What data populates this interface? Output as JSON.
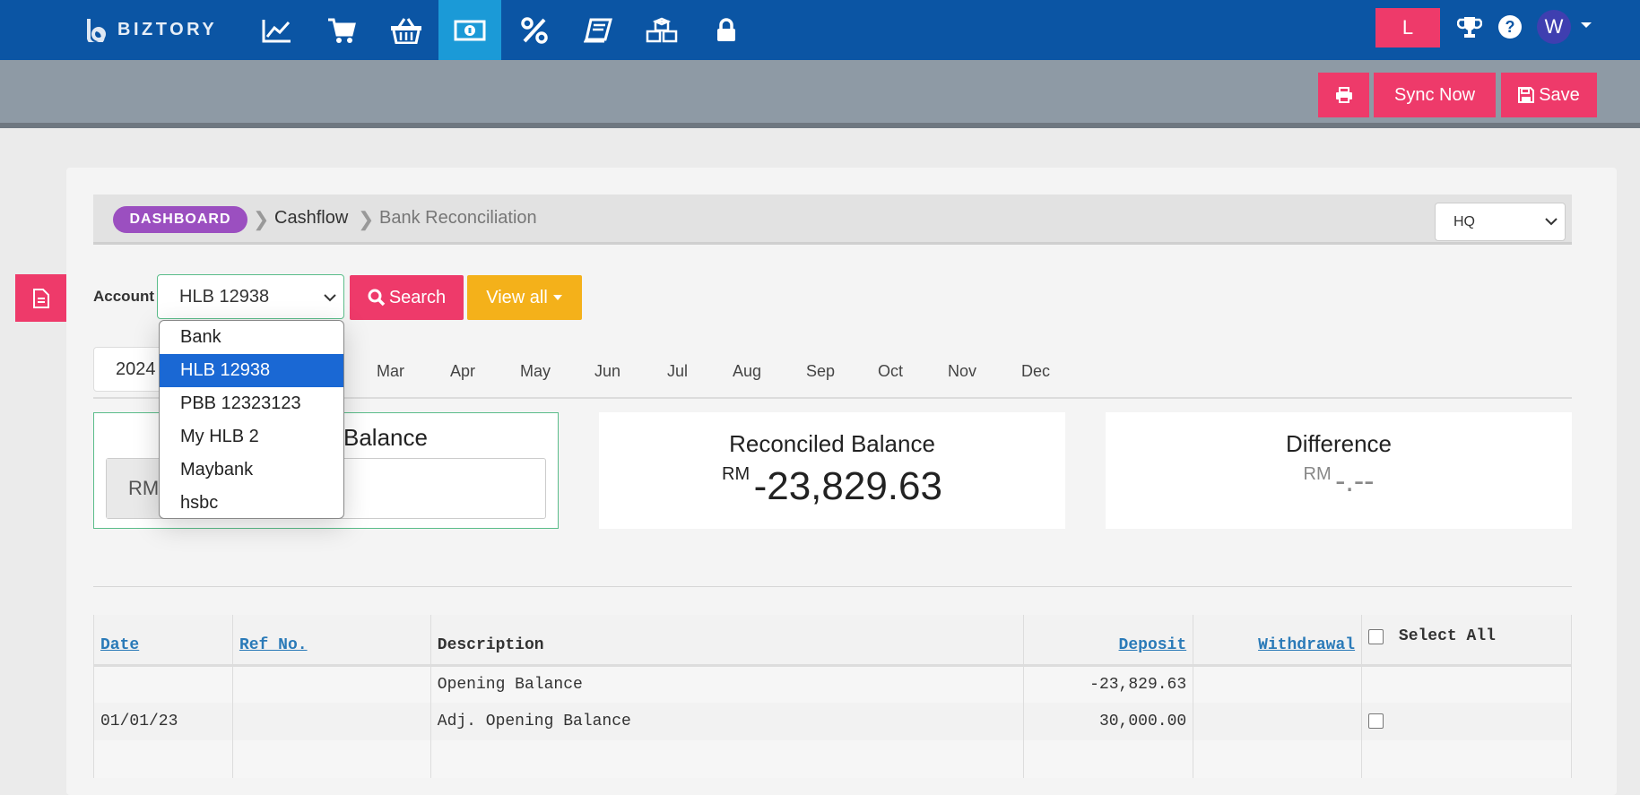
{
  "brand": {
    "name": "BIZTORY"
  },
  "nav": {
    "icons": [
      "chart-line-icon",
      "cart-icon",
      "basket-icon",
      "money-icon",
      "percent-icon",
      "book-icon",
      "cubes-icon",
      "lock-icon"
    ],
    "active": "money-icon"
  },
  "user": {
    "badge": "L",
    "avatar": "W"
  },
  "toolbar": {
    "sync_label": "Sync Now",
    "save_label": "Save"
  },
  "breadcrumb": {
    "dashboard": "DASHBOARD",
    "cashflow": "Cashflow",
    "current": "Bank Reconciliation"
  },
  "branch_select": {
    "value": "HQ"
  },
  "filter": {
    "account_label": "Account",
    "account_value": "HLB 12938",
    "search_label": "Search",
    "view_all_label": "View all",
    "account_options": [
      "Bank",
      "HLB 12938",
      "PBB 12323123",
      "My HLB 2",
      "Maybank",
      "hsbc"
    ],
    "selected_option": "HLB 12938"
  },
  "year": {
    "value": "2024"
  },
  "months": [
    "Mar",
    "Apr",
    "May",
    "Jun",
    "Jul",
    "Aug",
    "Sep",
    "Oct",
    "Nov",
    "Dec"
  ],
  "balances": {
    "statement": {
      "title_visible": "Balance",
      "prefix": "RM"
    },
    "reconciled": {
      "title": "Reconciled Balance",
      "currency": "RM",
      "value": "-23,829.63"
    },
    "difference": {
      "title": "Difference",
      "currency": "RM",
      "value": "-.--"
    }
  },
  "table": {
    "headers": {
      "date": "Date",
      "ref": "Ref No.",
      "description": "Description",
      "deposit": "Deposit",
      "withdrawal": "Withdrawal",
      "select_all": "Select All"
    },
    "rows": [
      {
        "date": "",
        "ref": "",
        "description": "Opening Balance",
        "deposit": "-23,829.63",
        "withdrawal": ""
      },
      {
        "date": "01/01/23",
        "ref": "",
        "description": "Adj. Opening Balance",
        "deposit": "30,000.00",
        "withdrawal": ""
      }
    ]
  },
  "colors": {
    "topbar": "#0b55a4",
    "active_nav": "#1b9ad7",
    "accent": "#ee3a6a",
    "warning": "#f4b11a",
    "dashboard_pill": "#9b4fc0"
  }
}
